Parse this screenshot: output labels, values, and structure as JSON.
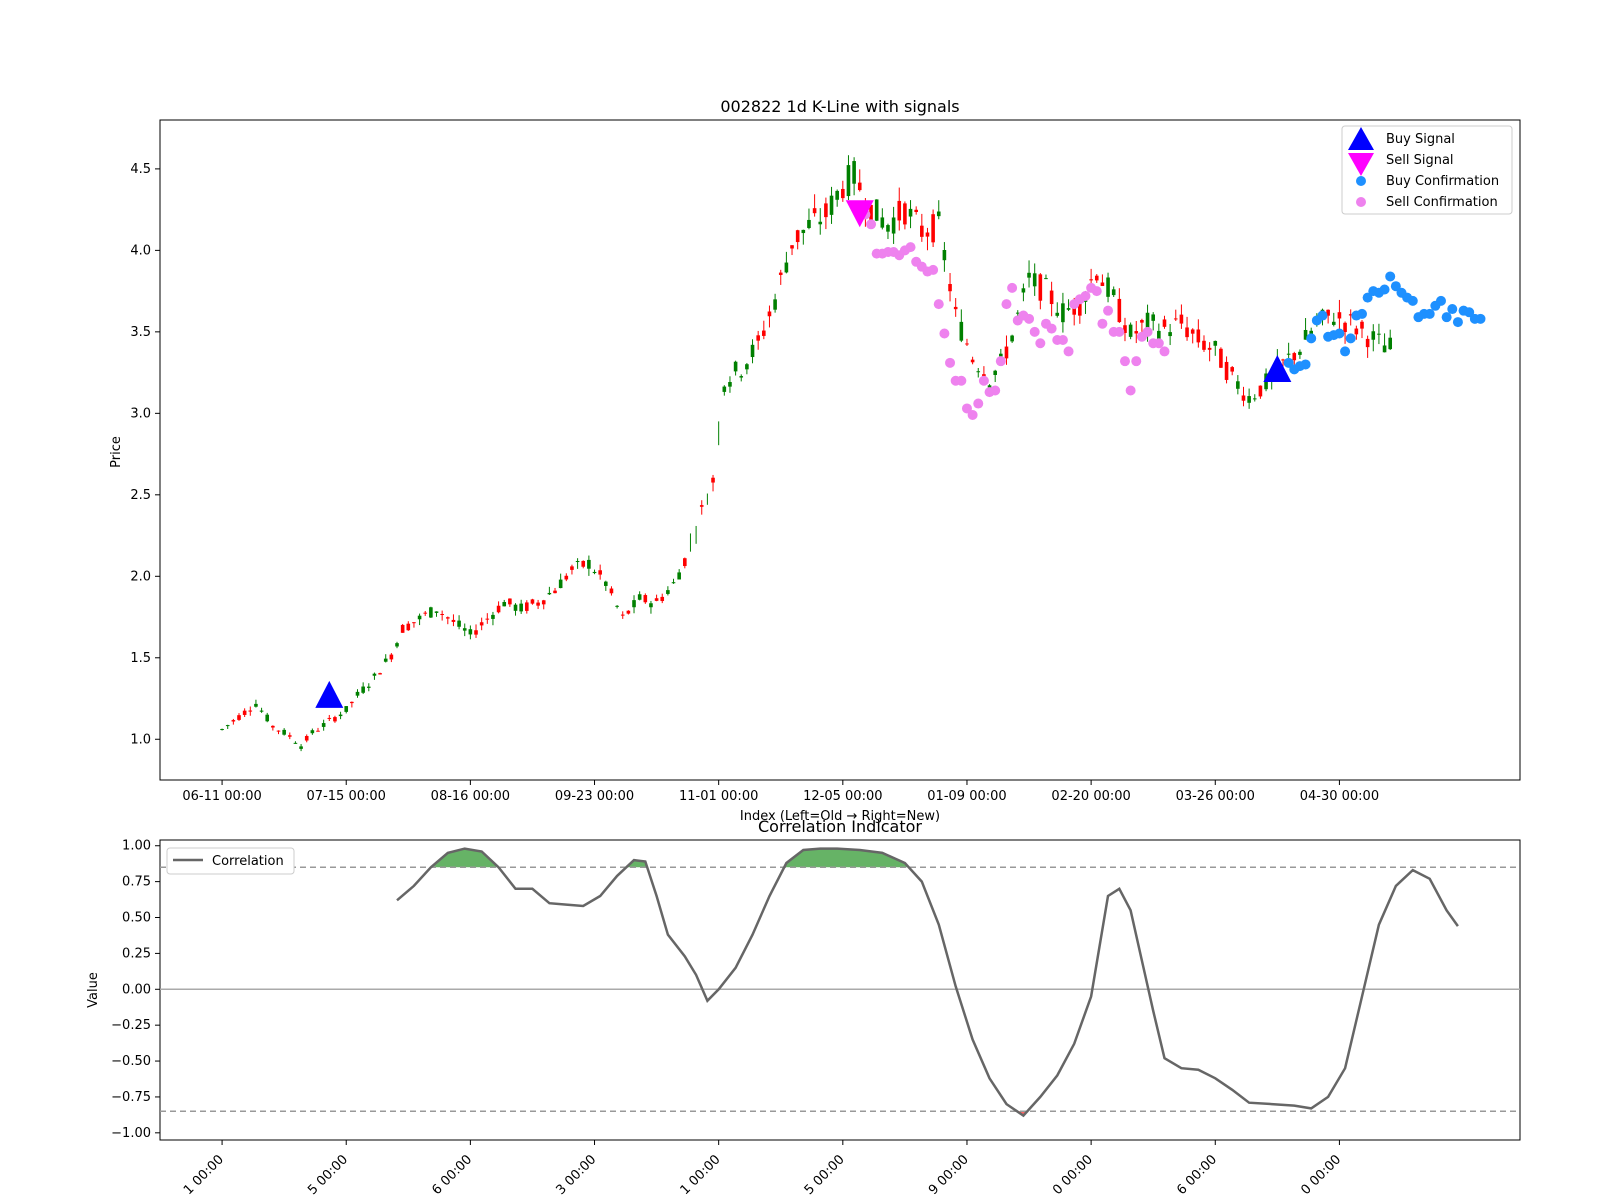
{
  "chart_data": [
    {
      "type": "candlestick",
      "title": "002822 1d K-Line with signals",
      "xlabel": "Index (Left=Old → Right=New)",
      "ylabel": "Price",
      "ylim": [
        0.75,
        4.8
      ],
      "yticks": [
        "1.0",
        "1.5",
        "2.0",
        "2.5",
        "3.0",
        "3.5",
        "4.0",
        "4.5"
      ],
      "xtick_labels": [
        "06-11 00:00",
        "07-15 00:00",
        "08-16 00:00",
        "09-23 00:00",
        "11-01 00:00",
        "12-05 00:00",
        "01-09 00:00",
        "02-20 00:00",
        "03-26 00:00",
        "04-30 00:00"
      ],
      "xtick_index": [
        0,
        22,
        44,
        66,
        88,
        110,
        132,
        154,
        176,
        198
      ],
      "index_range": [
        -11,
        230
      ],
      "colors": {
        "up": "#008000",
        "down": "#ff0000",
        "buy_signal": "#0000ff",
        "sell_signal": "#ff00ff",
        "buy_confirmation": "#1e90ff",
        "sell_confirmation": "#ee82ee"
      },
      "anchors": [
        [
          0,
          1.06
        ],
        [
          3,
          1.14
        ],
        [
          6,
          1.22
        ],
        [
          9,
          1.08
        ],
        [
          12,
          1.02
        ],
        [
          14,
          0.96
        ],
        [
          16,
          1.04
        ],
        [
          19,
          1.11
        ],
        [
          22,
          1.18
        ],
        [
          24,
          1.27
        ],
        [
          27,
          1.38
        ],
        [
          30,
          1.52
        ],
        [
          32,
          1.68
        ],
        [
          35,
          1.74
        ],
        [
          38,
          1.8
        ],
        [
          41,
          1.72
        ],
        [
          44,
          1.64
        ],
        [
          47,
          1.74
        ],
        [
          50,
          1.84
        ],
        [
          53,
          1.8
        ],
        [
          56,
          1.84
        ],
        [
          59,
          1.92
        ],
        [
          62,
          2.04
        ],
        [
          65,
          2.08
        ],
        [
          68,
          1.96
        ],
        [
          71,
          1.74
        ],
        [
          74,
          1.86
        ],
        [
          77,
          1.84
        ],
        [
          80,
          1.95
        ],
        [
          82,
          2.1
        ],
        [
          85,
          2.4
        ],
        [
          87,
          2.59
        ],
        [
          89,
          3.2
        ],
        [
          92,
          3.28
        ],
        [
          95,
          3.42
        ],
        [
          98,
          3.7
        ],
        [
          101,
          4.05
        ],
        [
          104,
          4.15
        ],
        [
          107,
          4.22
        ],
        [
          110,
          4.4
        ],
        [
          112,
          4.46
        ],
        [
          115,
          4.25
        ],
        [
          118,
          4.16
        ],
        [
          121,
          4.25
        ],
        [
          124,
          4.12
        ],
        [
          127,
          4.15
        ],
        [
          130,
          3.6
        ],
        [
          133,
          3.35
        ],
        [
          136,
          3.22
        ],
        [
          138,
          3.3
        ],
        [
          140,
          3.48
        ],
        [
          143,
          3.82
        ],
        [
          146,
          3.75
        ],
        [
          149,
          3.62
        ],
        [
          152,
          3.68
        ],
        [
          155,
          3.88
        ],
        [
          158,
          3.7
        ],
        [
          161,
          3.48
        ],
        [
          164,
          3.55
        ],
        [
          167,
          3.52
        ],
        [
          170,
          3.55
        ],
        [
          173,
          3.45
        ],
        [
          176,
          3.38
        ],
        [
          179,
          3.22
        ],
        [
          182,
          3.1
        ],
        [
          185,
          3.18
        ],
        [
          188,
          3.3
        ],
        [
          191,
          3.4
        ],
        [
          194,
          3.55
        ],
        [
          197,
          3.6
        ],
        [
          200,
          3.55
        ],
        [
          203,
          3.48
        ],
        [
          205,
          3.43
        ],
        [
          207,
          3.4
        ]
      ],
      "signals": {
        "buy": [
          {
            "x": 19,
            "y": 1.26
          },
          {
            "x": 187,
            "y": 3.26
          }
        ],
        "sell": [
          {
            "x": 113,
            "y": 4.24
          }
        ]
      },
      "buy_confirmation": [
        [
          189,
          3.31
        ],
        [
          190,
          3.27
        ],
        [
          191,
          3.29
        ],
        [
          192,
          3.3
        ],
        [
          193,
          3.46
        ],
        [
          194,
          3.57
        ],
        [
          195,
          3.6
        ],
        [
          196,
          3.47
        ],
        [
          197,
          3.48
        ],
        [
          198,
          3.49
        ],
        [
          199,
          3.38
        ],
        [
          200,
          3.46
        ],
        [
          201,
          3.6
        ],
        [
          202,
          3.61
        ],
        [
          203,
          3.71
        ],
        [
          204,
          3.75
        ],
        [
          205,
          3.74
        ],
        [
          206,
          3.76
        ],
        [
          207,
          3.84
        ],
        [
          208,
          3.78
        ],
        [
          209,
          3.74
        ],
        [
          210,
          3.71
        ],
        [
          211,
          3.69
        ],
        [
          212,
          3.59
        ],
        [
          213,
          3.61
        ],
        [
          214,
          3.61
        ],
        [
          215,
          3.66
        ],
        [
          216,
          3.69
        ],
        [
          217,
          3.59
        ],
        [
          218,
          3.64
        ],
        [
          219,
          3.56
        ],
        [
          220,
          3.63
        ],
        [
          221,
          3.62
        ],
        [
          222,
          3.58
        ],
        [
          223,
          3.58
        ]
      ],
      "sell_confirmation": [
        [
          114,
          4.22
        ],
        [
          115,
          4.16
        ],
        [
          116,
          3.98
        ],
        [
          117,
          3.98
        ],
        [
          118,
          3.99
        ],
        [
          119,
          3.99
        ],
        [
          120,
          3.97
        ],
        [
          121,
          4.0
        ],
        [
          122,
          4.02
        ],
        [
          123,
          3.93
        ],
        [
          124,
          3.9
        ],
        [
          125,
          3.87
        ],
        [
          126,
          3.88
        ],
        [
          127,
          3.67
        ],
        [
          128,
          3.49
        ],
        [
          129,
          3.31
        ],
        [
          130,
          3.2
        ],
        [
          131,
          3.2
        ],
        [
          132,
          3.03
        ],
        [
          133,
          2.99
        ],
        [
          134,
          3.06
        ],
        [
          135,
          3.2
        ],
        [
          136,
          3.13
        ],
        [
          137,
          3.14
        ],
        [
          138,
          3.32
        ],
        [
          139,
          3.67
        ],
        [
          140,
          3.77
        ],
        [
          141,
          3.57
        ],
        [
          142,
          3.6
        ],
        [
          143,
          3.58
        ],
        [
          144,
          3.5
        ],
        [
          145,
          3.43
        ],
        [
          146,
          3.55
        ],
        [
          147,
          3.52
        ],
        [
          148,
          3.45
        ],
        [
          149,
          3.45
        ],
        [
          150,
          3.38
        ],
        [
          151,
          3.67
        ],
        [
          152,
          3.7
        ],
        [
          153,
          3.72
        ],
        [
          154,
          3.77
        ],
        [
          155,
          3.75
        ],
        [
          156,
          3.55
        ],
        [
          157,
          3.63
        ],
        [
          158,
          3.5
        ],
        [
          159,
          3.5
        ],
        [
          160,
          3.32
        ],
        [
          161,
          3.14
        ],
        [
          162,
          3.32
        ],
        [
          163,
          3.47
        ],
        [
          164,
          3.5
        ],
        [
          165,
          3.43
        ],
        [
          166,
          3.43
        ],
        [
          167,
          3.38
        ]
      ],
      "legend": {
        "position": "top-right",
        "entries": [
          "Buy Signal",
          "Sell Signal",
          "Buy Confirmation",
          "Sell Confirmation"
        ]
      }
    },
    {
      "type": "line",
      "title": "Correlation Indicator",
      "ylabel": "Value",
      "ylim": [
        -1.05,
        1.04
      ],
      "yticks": [
        "1.00",
        "0.75",
        "0.50",
        "0.25",
        "0.00",
        "−0.25",
        "−0.50",
        "−0.75",
        "−1.00"
      ],
      "ytick_values": [
        1,
        0.75,
        0.5,
        0.25,
        0,
        -0.25,
        -0.5,
        -0.75,
        -1
      ],
      "thresholds": [
        0.85,
        -0.85
      ],
      "zero_line": 0,
      "xtick_labels": [
        "1 00:00",
        "5 00:00",
        "6 00:00",
        "3 00:00",
        "1 00:00",
        "5 00:00",
        "9 00:00",
        "0 00:00",
        "6 00:00",
        "0 00:00"
      ],
      "xtick_index": [
        0,
        22,
        44,
        66,
        88,
        110,
        132,
        154,
        176,
        198
      ],
      "colors": {
        "line": "#666666",
        "fill_high": "#008000",
        "fill_low": "#ff0000",
        "threshold": "#999999"
      },
      "series": [
        {
          "name": "Correlation",
          "points": [
            [
              31,
              0.62
            ],
            [
              34,
              0.72
            ],
            [
              37,
              0.85
            ],
            [
              40,
              0.95
            ],
            [
              43,
              0.98
            ],
            [
              46,
              0.96
            ],
            [
              49,
              0.85
            ],
            [
              52,
              0.7
            ],
            [
              55,
              0.7
            ],
            [
              58,
              0.6
            ],
            [
              61,
              0.59
            ],
            [
              64,
              0.58
            ],
            [
              67,
              0.65
            ],
            [
              70,
              0.79
            ],
            [
              73,
              0.9
            ],
            [
              75,
              0.89
            ],
            [
              77,
              0.65
            ],
            [
              79,
              0.38
            ],
            [
              82,
              0.23
            ],
            [
              84,
              0.1
            ],
            [
              86,
              -0.08
            ],
            [
              88,
              0.0
            ],
            [
              91,
              0.15
            ],
            [
              94,
              0.38
            ],
            [
              97,
              0.65
            ],
            [
              100,
              0.88
            ],
            [
              103,
              0.97
            ],
            [
              106,
              0.98
            ],
            [
              109,
              0.98
            ],
            [
              113,
              0.97
            ],
            [
              117,
              0.95
            ],
            [
              121,
              0.88
            ],
            [
              124,
              0.75
            ],
            [
              127,
              0.45
            ],
            [
              130,
              0.02
            ],
            [
              133,
              -0.35
            ],
            [
              136,
              -0.62
            ],
            [
              139,
              -0.8
            ],
            [
              142,
              -0.88
            ],
            [
              145,
              -0.75
            ],
            [
              148,
              -0.6
            ],
            [
              151,
              -0.38
            ],
            [
              154,
              -0.05
            ],
            [
              157,
              0.65
            ],
            [
              159,
              0.7
            ],
            [
              161,
              0.55
            ],
            [
              163,
              0.2
            ],
            [
              165,
              -0.15
            ],
            [
              167,
              -0.48
            ],
            [
              170,
              -0.55
            ],
            [
              173,
              -0.56
            ],
            [
              176,
              -0.62
            ],
            [
              179,
              -0.7
            ],
            [
              182,
              -0.79
            ],
            [
              186,
              -0.8
            ],
            [
              190,
              -0.81
            ],
            [
              193,
              -0.83
            ],
            [
              196,
              -0.75
            ],
            [
              199,
              -0.55
            ],
            [
              202,
              -0.05
            ],
            [
              205,
              0.45
            ],
            [
              208,
              0.72
            ],
            [
              211,
              0.83
            ],
            [
              214,
              0.77
            ],
            [
              217,
              0.55
            ],
            [
              219,
              0.44
            ]
          ]
        }
      ],
      "legend": {
        "position": "top-left",
        "entries": [
          "Correlation"
        ]
      }
    }
  ]
}
